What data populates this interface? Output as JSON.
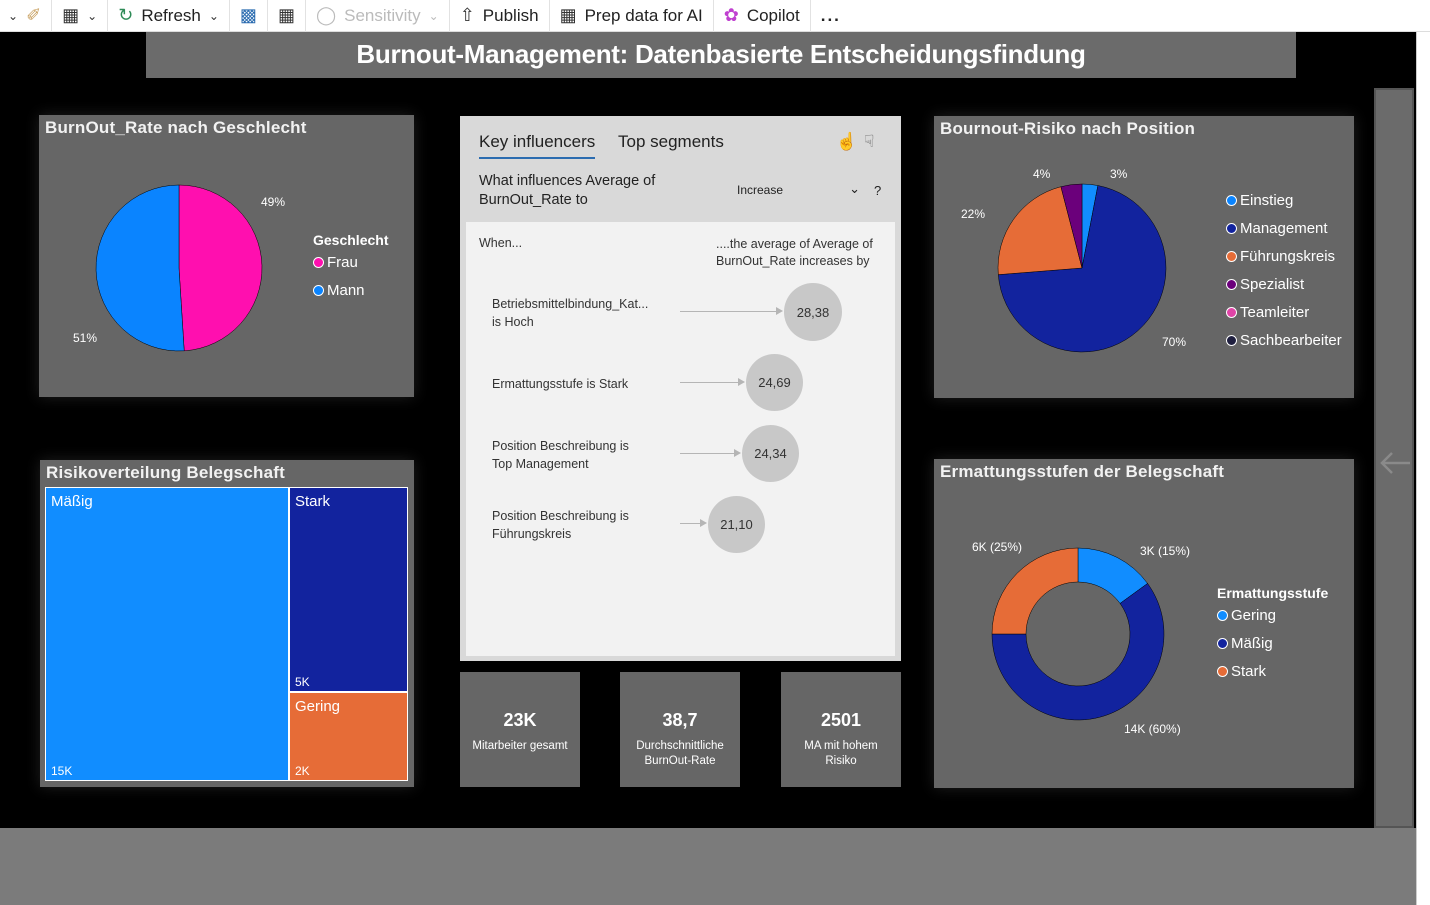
{
  "toolbar": {
    "refresh": "Refresh",
    "sensitivity": "Sensitivity",
    "publish": "Publish",
    "prep_ai": "Prep data for AI",
    "copilot": "Copilot",
    "more": "..."
  },
  "report": {
    "title": "Burnout-Management: Datenbasierte Entscheidungsfindung"
  },
  "gender_chart": {
    "title": "BurnOut_Rate nach Geschlecht",
    "legend_title": "Geschlecht",
    "legend": [
      {
        "label": "Frau",
        "color": "#FF0FAF"
      },
      {
        "label": "Mann",
        "color": "#0A84FF"
      }
    ],
    "labels": {
      "frau": "49%",
      "mann": "51%"
    }
  },
  "position_chart": {
    "title": "Bournout-Risiko nach Position",
    "legend": [
      {
        "label": "Einstieg",
        "color": "#0A84FF"
      },
      {
        "label": "Management",
        "color": "#12239E"
      },
      {
        "label": "Führungskreis",
        "color": "#E66C37"
      },
      {
        "label": "Spezialist",
        "color": "#6B007B"
      },
      {
        "label": "Teamleiter",
        "color": "#E044A7"
      },
      {
        "label": "Sachbearbeiter",
        "color": "#1F1F3F"
      }
    ],
    "labels": {
      "management": "70%",
      "fuehrung": "22%",
      "spezialist": "4%",
      "einstieg": "3%"
    }
  },
  "risk_treemap": {
    "title": "Risikoverteilung Belegschaft",
    "cells": [
      {
        "name": "Mäßig",
        "value": "15K",
        "color": "#118DFF"
      },
      {
        "name": "Stark",
        "value": "5K",
        "color": "#12239E"
      },
      {
        "name": "Gering",
        "value": "2K",
        "color": "#E66C37"
      }
    ]
  },
  "fatigue_chart": {
    "title": "Ermattungsstufen der Belegschaft",
    "legend_title": "Ermattungsstufe",
    "legend": [
      {
        "label": "Gering",
        "color": "#118DFF"
      },
      {
        "label": "Mäßig",
        "color": "#12239E"
      },
      {
        "label": "Stark",
        "color": "#E66C37"
      }
    ],
    "labels": {
      "stark": "6K (25%)",
      "gering": "3K (15%)",
      "maessig": "14K (60%)"
    }
  },
  "key_influencers": {
    "tab_active": "Key influencers",
    "tab_other": "Top segments",
    "question_line1": "What influences Average of",
    "question_line2": "BurnOut_Rate to",
    "dropdown_value": "Increase",
    "help": "?",
    "when_header": "When...",
    "result_header_line1": "....the average of Average of",
    "result_header_line2": "BurnOut_Rate increases by",
    "rows": [
      {
        "line1": "Betriebsmittelbindung_Kat...",
        "line2": "is Hoch",
        "value": "28,38"
      },
      {
        "line1": "Ermattungsstufe is Stark",
        "line2": "",
        "value": "24,69"
      },
      {
        "line1": "Position Beschreibung is",
        "line2": "Top Management",
        "value": "24,34"
      },
      {
        "line1": "Position Beschreibung is",
        "line2": "Führungskreis",
        "value": "21,10"
      }
    ]
  },
  "kpis": [
    {
      "value": "23K",
      "label_line1": "Mitarbeiter gesamt",
      "label_line2": ""
    },
    {
      "value": "38,7",
      "label_line1": "Durchschnittliche",
      "label_line2": "BurnOut-Rate"
    },
    {
      "value": "2501",
      "label_line1": "MA mit hohem",
      "label_line2": "Risiko"
    }
  ],
  "chart_data": [
    {
      "type": "pie",
      "title": "BurnOut_Rate nach Geschlecht",
      "categories": [
        "Frau",
        "Mann"
      ],
      "values": [
        49,
        51
      ]
    },
    {
      "type": "pie",
      "title": "Bournout-Risiko nach Position",
      "categories": [
        "Einstieg",
        "Management",
        "Führungskreis",
        "Spezialist"
      ],
      "values": [
        3,
        70,
        22,
        4
      ]
    },
    {
      "type": "pie",
      "title": "Ermattungsstufen der Belegschaft",
      "categories": [
        "Gering",
        "Mäßig",
        "Stark"
      ],
      "values": [
        15,
        60,
        25
      ]
    }
  ]
}
